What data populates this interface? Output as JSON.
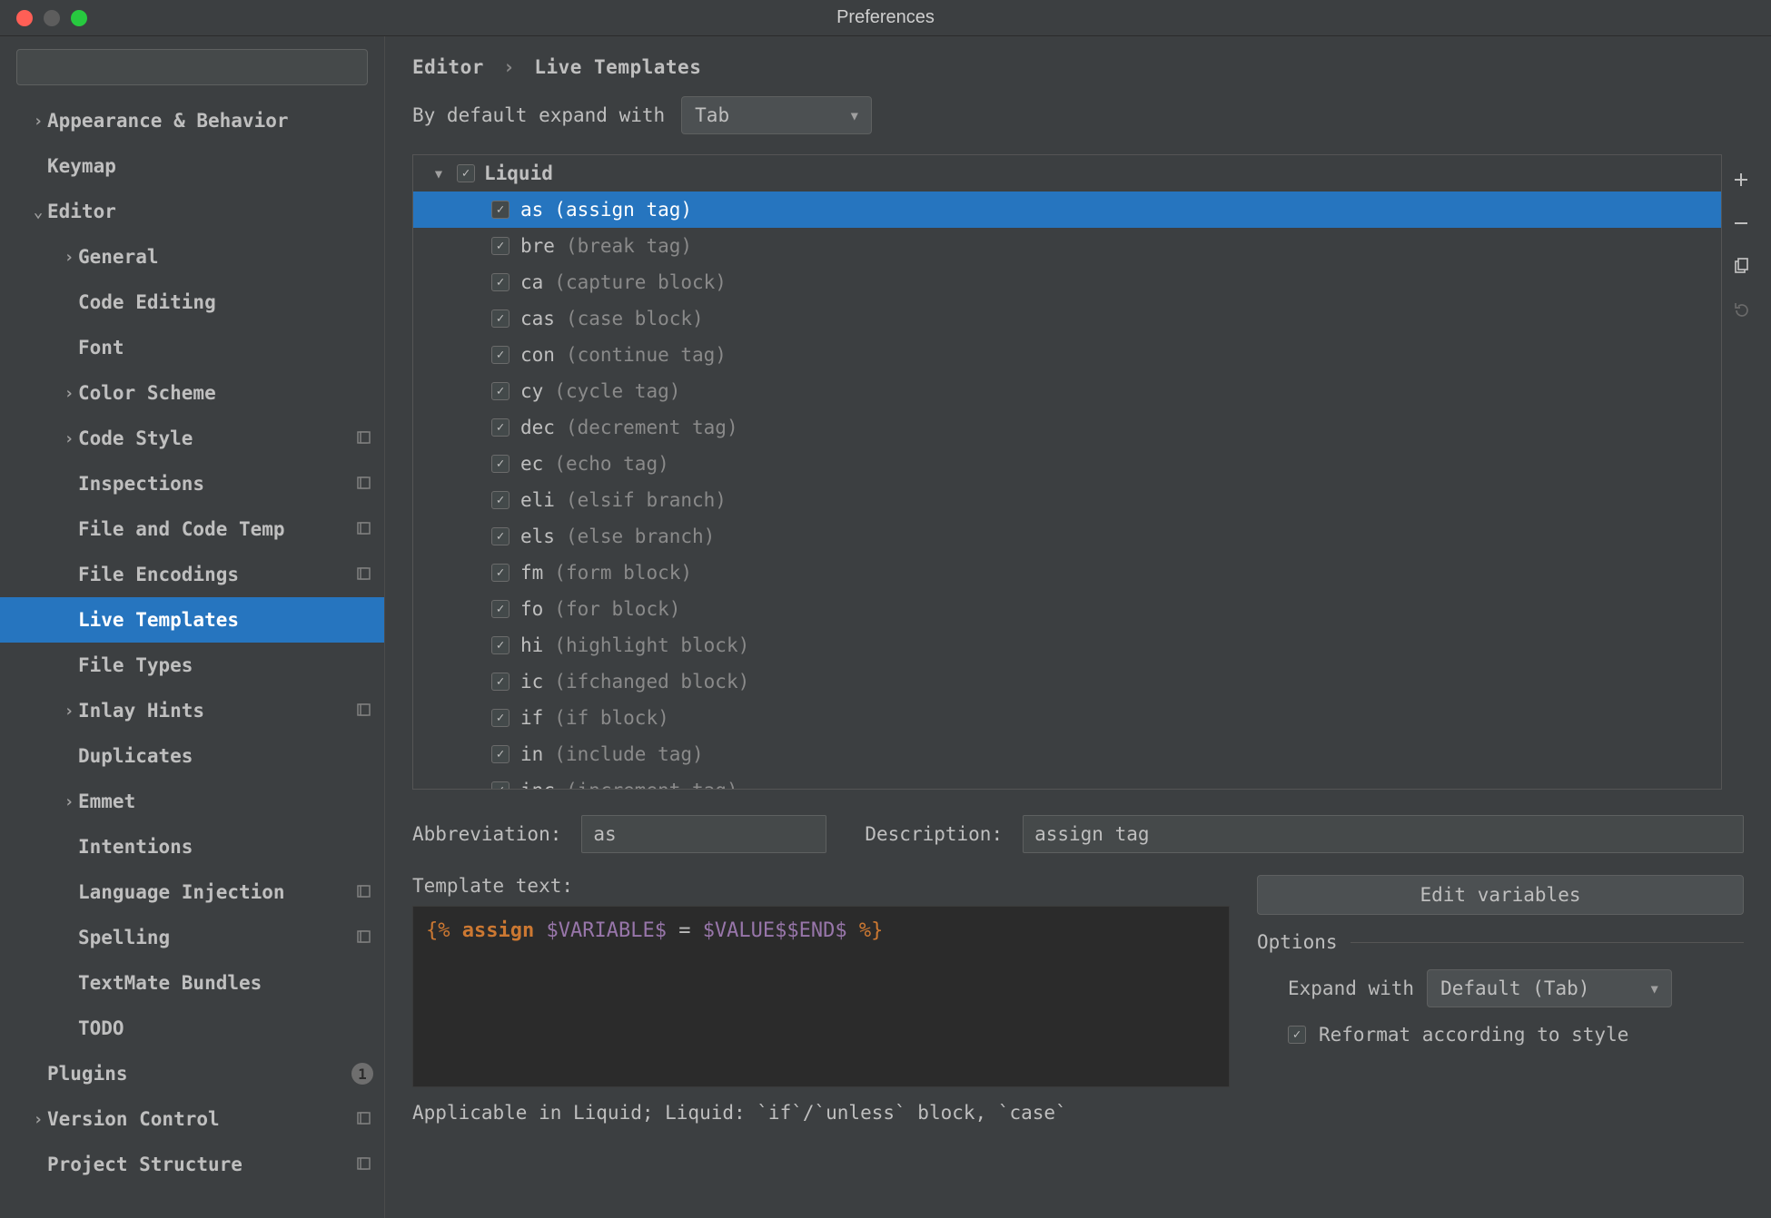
{
  "window": {
    "title": "Preferences"
  },
  "search": {
    "placeholder": ""
  },
  "sidebar": [
    {
      "label": "Appearance & Behavior",
      "indent": 0,
      "chevron": "right",
      "scheme": false
    },
    {
      "label": "Keymap",
      "indent": 0,
      "chevron": "",
      "scheme": false
    },
    {
      "label": "Editor",
      "indent": 0,
      "chevron": "down",
      "scheme": false
    },
    {
      "label": "General",
      "indent": 1,
      "chevron": "right",
      "scheme": false
    },
    {
      "label": "Code Editing",
      "indent": 1,
      "chevron": "",
      "scheme": false
    },
    {
      "label": "Font",
      "indent": 1,
      "chevron": "",
      "scheme": false
    },
    {
      "label": "Color Scheme",
      "indent": 1,
      "chevron": "right",
      "scheme": false
    },
    {
      "label": "Code Style",
      "indent": 1,
      "chevron": "right",
      "scheme": true
    },
    {
      "label": "Inspections",
      "indent": 1,
      "chevron": "",
      "scheme": true
    },
    {
      "label": "File and Code Temp",
      "indent": 1,
      "chevron": "",
      "scheme": true
    },
    {
      "label": "File Encodings",
      "indent": 1,
      "chevron": "",
      "scheme": true
    },
    {
      "label": "Live Templates",
      "indent": 1,
      "chevron": "",
      "scheme": false,
      "selected": true
    },
    {
      "label": "File Types",
      "indent": 1,
      "chevron": "",
      "scheme": false
    },
    {
      "label": "Inlay Hints",
      "indent": 1,
      "chevron": "right",
      "scheme": true
    },
    {
      "label": "Duplicates",
      "indent": 1,
      "chevron": "",
      "scheme": false
    },
    {
      "label": "Emmet",
      "indent": 1,
      "chevron": "right",
      "scheme": false
    },
    {
      "label": "Intentions",
      "indent": 1,
      "chevron": "",
      "scheme": false
    },
    {
      "label": "Language Injection",
      "indent": 1,
      "chevron": "",
      "scheme": true
    },
    {
      "label": "Spelling",
      "indent": 1,
      "chevron": "",
      "scheme": true
    },
    {
      "label": "TextMate Bundles",
      "indent": 1,
      "chevron": "",
      "scheme": false
    },
    {
      "label": "TODO",
      "indent": 1,
      "chevron": "",
      "scheme": false
    },
    {
      "label": "Plugins",
      "indent": 0,
      "chevron": "",
      "scheme": false,
      "badge": "1"
    },
    {
      "label": "Version Control",
      "indent": 0,
      "chevron": "right",
      "scheme": true
    },
    {
      "label": "Project Structure",
      "indent": 0,
      "chevron": "",
      "scheme": true
    }
  ],
  "breadcrumb": {
    "a": "Editor",
    "b": "Live Templates"
  },
  "expand": {
    "label": "By default expand with",
    "value": "Tab"
  },
  "group": {
    "name": "Liquid",
    "checked": true
  },
  "templates": [
    {
      "abbr": "as",
      "desc": "(assign tag)",
      "selected": true
    },
    {
      "abbr": "bre",
      "desc": "(break tag)"
    },
    {
      "abbr": "ca",
      "desc": "(capture block)"
    },
    {
      "abbr": "cas",
      "desc": "(case block)"
    },
    {
      "abbr": "con",
      "desc": "(continue tag)"
    },
    {
      "abbr": "cy",
      "desc": "(cycle tag)"
    },
    {
      "abbr": "dec",
      "desc": "(decrement tag)"
    },
    {
      "abbr": "ec",
      "desc": "(echo tag)"
    },
    {
      "abbr": "eli",
      "desc": "(elsif branch)"
    },
    {
      "abbr": "els",
      "desc": "(else branch)"
    },
    {
      "abbr": "fm",
      "desc": "(form block)"
    },
    {
      "abbr": "fo",
      "desc": "(for block)"
    },
    {
      "abbr": "hi",
      "desc": "(highlight block)"
    },
    {
      "abbr": "ic",
      "desc": "(ifchanged block)"
    },
    {
      "abbr": "if",
      "desc": "(if block)"
    },
    {
      "abbr": "in",
      "desc": "(include tag)"
    },
    {
      "abbr": "inc",
      "desc": "(increment tag)"
    }
  ],
  "form": {
    "abbr_label": "Abbreviation:",
    "abbr_value": "as",
    "desc_label": "Description:",
    "desc_value": "assign tag",
    "tmpl_label": "Template text:",
    "edit_vars": "Edit variables",
    "options": "Options",
    "expand_with_label": "Expand with",
    "expand_with_value": "Default (Tab)",
    "reformat_label": "Reformat according to style",
    "reformat_checked": true,
    "applicable": "Applicable in Liquid; Liquid: `if`/`unless` block, `case`"
  },
  "template_text": {
    "open": "{%",
    "kw": "assign",
    "v1": "$VARIABLE$",
    "eq": "=",
    "v2": "$VALUE$$END$",
    "close": "%}"
  }
}
